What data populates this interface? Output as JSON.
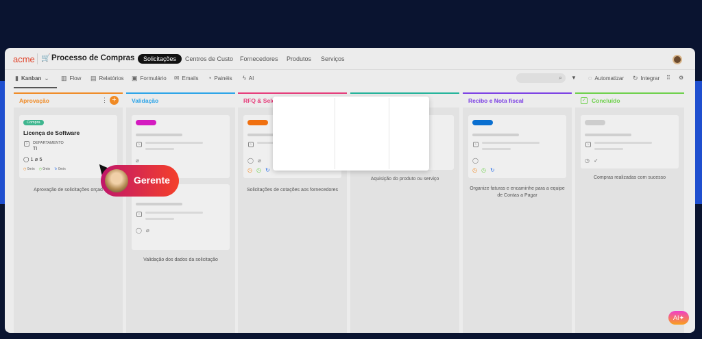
{
  "app": {
    "logo": "acme",
    "title": "Processo de Compras"
  },
  "nav_tabs": [
    {
      "label": "Solicitações",
      "active": true
    },
    {
      "label": "Centros de Custo"
    },
    {
      "label": "Fornecedores"
    },
    {
      "label": "Produtos"
    },
    {
      "label": "Serviços"
    }
  ],
  "toolbar": {
    "items": [
      {
        "label": "Kanban",
        "icon": "kanban-icon"
      },
      {
        "label": "Flow",
        "icon": "flow-icon"
      },
      {
        "label": "Relatórios",
        "icon": "table-icon"
      },
      {
        "label": "Formulário",
        "icon": "form-icon"
      },
      {
        "label": "Emails",
        "icon": "mail-icon"
      },
      {
        "label": "Painéis",
        "icon": "pie-icon"
      },
      {
        "label": "AI",
        "icon": "sparkle-icon"
      }
    ],
    "automatizar": "Automatizar",
    "integrar": "Integrar"
  },
  "columns": [
    {
      "title": "Aprovação",
      "color": "#f08a24",
      "description": "Aprovação de solicitações orçad"
    },
    {
      "title": "Validação",
      "color": "#2aa3e8",
      "description": "Validação dos dados da solicitação"
    },
    {
      "title": "RFQ & Sele",
      "color": "#e63b7a",
      "description": "Solicitações de cotações aos fornecedores"
    },
    {
      "title": "",
      "color": "#22b39a",
      "description": "Aquisição do produto ou serviço"
    },
    {
      "title": "Recibo e Nota fiscal",
      "color": "#7b3fe4",
      "description": "Organize faturas e encaminhe para a equipe de Contas a Pagar"
    },
    {
      "title": "Concluído",
      "color": "#6dd04a",
      "description": "Compras realizadas com sucesso"
    }
  ],
  "card": {
    "tag": "Compra",
    "title": "Licença de Software",
    "field_label": "DEPARTAMENTO",
    "field_value": "TI",
    "comments": "1",
    "attachments": "5",
    "timers": [
      "0min",
      "0min",
      "0min"
    ]
  },
  "overlay": {
    "label": "Gerente"
  },
  "ai_button": "AI"
}
